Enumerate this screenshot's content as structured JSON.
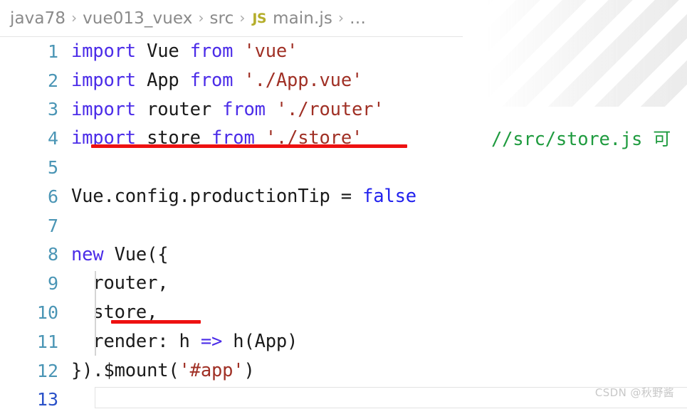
{
  "breadcrumb": {
    "separator": "›",
    "file_icon_label": "JS",
    "items": [
      {
        "label": "java78"
      },
      {
        "label": "vue013_vuex"
      },
      {
        "label": "src"
      },
      {
        "label": "main.js"
      },
      {
        "label": "…"
      }
    ]
  },
  "editor": {
    "language": "javascript",
    "active_line": 13,
    "lines": [
      {
        "number": "1",
        "tokens": [
          {
            "t": "import",
            "c": "kw"
          },
          {
            "t": " Vue ",
            "c": "plain"
          },
          {
            "t": "from",
            "c": "kw"
          },
          {
            "t": " ",
            "c": "plain"
          },
          {
            "t": "'vue'",
            "c": "str"
          }
        ]
      },
      {
        "number": "2",
        "tokens": [
          {
            "t": "import",
            "c": "kw"
          },
          {
            "t": " App ",
            "c": "plain"
          },
          {
            "t": "from",
            "c": "kw"
          },
          {
            "t": " ",
            "c": "plain"
          },
          {
            "t": "'./App.vue'",
            "c": "str"
          }
        ]
      },
      {
        "number": "3",
        "tokens": [
          {
            "t": "import",
            "c": "kw"
          },
          {
            "t": " router ",
            "c": "plain"
          },
          {
            "t": "from",
            "c": "kw"
          },
          {
            "t": " ",
            "c": "plain"
          },
          {
            "t": "'./router'",
            "c": "str"
          }
        ]
      },
      {
        "number": "4",
        "tokens": [
          {
            "t": "import",
            "c": "kw"
          },
          {
            "t": " store ",
            "c": "plain"
          },
          {
            "t": "from",
            "c": "kw"
          },
          {
            "t": " ",
            "c": "plain"
          },
          {
            "t": "'./store'",
            "c": "str"
          }
        ]
      },
      {
        "number": "5",
        "tokens": []
      },
      {
        "number": "6",
        "tokens": [
          {
            "t": "Vue.config.productionTip = ",
            "c": "plain"
          },
          {
            "t": "false",
            "c": "bool"
          }
        ]
      },
      {
        "number": "7",
        "tokens": []
      },
      {
        "number": "8",
        "tokens": [
          {
            "t": "new",
            "c": "kw"
          },
          {
            "t": " Vue({",
            "c": "plain"
          }
        ]
      },
      {
        "number": "9",
        "tokens": [
          {
            "t": "  router,",
            "c": "plain"
          }
        ]
      },
      {
        "number": "10",
        "tokens": [
          {
            "t": "  store,",
            "c": "plain"
          }
        ]
      },
      {
        "number": "11",
        "tokens": [
          {
            "t": "  render: h ",
            "c": "plain"
          },
          {
            "t": "=>",
            "c": "kw"
          },
          {
            "t": " h(App)",
            "c": "plain"
          }
        ]
      },
      {
        "number": "12",
        "tokens": [
          {
            "t": "}).$mount(",
            "c": "plain"
          },
          {
            "t": "'#app'",
            "c": "str"
          },
          {
            "t": ")",
            "c": "plain"
          }
        ]
      },
      {
        "number": "13",
        "tokens": []
      }
    ]
  },
  "annotations": {
    "side_comment": {
      "text_ascii": "//src/store.js ",
      "text_cjk": "可"
    },
    "underlines": [
      {
        "target_line": 4,
        "target_text": "import store from './store'"
      },
      {
        "target_line": 10,
        "target_text": "store,"
      }
    ]
  },
  "watermark": {
    "text": "CSDN @秋野酱"
  },
  "colors": {
    "keyword": "#4b2ce8",
    "string": "#a03025",
    "boolean": "#2222ee",
    "comment": "#1f9b3f",
    "plain": "#1a1a1a",
    "line_number": "#4a95b5",
    "line_number_active": "#2a51c8",
    "annotation_red": "#ee1111",
    "js_badge": "#b5ae2c",
    "breadcrumb_text": "#8a8a8a"
  }
}
